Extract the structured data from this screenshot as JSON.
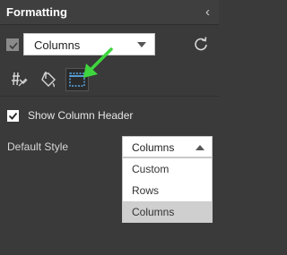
{
  "header": {
    "title": "Formatting"
  },
  "main_select": {
    "value": "Columns"
  },
  "show_column_header": {
    "label": "Show Column Header",
    "checked": true
  },
  "default_style": {
    "label": "Default Style",
    "value": "Columns",
    "options": [
      "Custom",
      "Rows",
      "Columns"
    ],
    "selected_index": 2
  },
  "icons": {
    "collapse": "chevron-left-icon",
    "reset": "reset-icon",
    "tab1": "conditional-format-icon",
    "tab2": "paint-bucket-icon",
    "tab3": "column-header-icon",
    "annotation": "arrow-annotation-icon"
  },
  "colors": {
    "panel_bg": "#3a3a3a",
    "header_bg": "#3f3f3f",
    "arrow": "#3ed63e",
    "selected_option": "#cfcfcf"
  }
}
